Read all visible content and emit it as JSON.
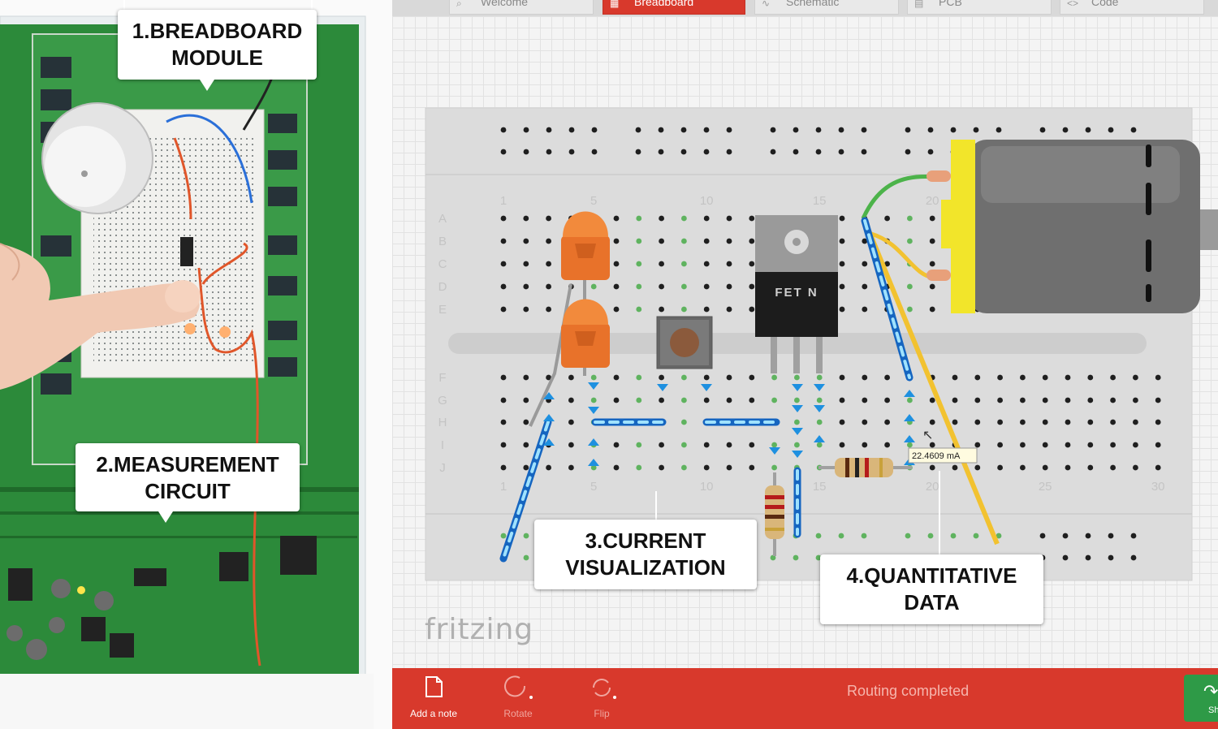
{
  "tabs": [
    {
      "label": "Welcome",
      "icon": "welcome-icon",
      "active": false
    },
    {
      "label": "Breadboard",
      "icon": "breadboard-icon",
      "active": true
    },
    {
      "label": "Schematic",
      "icon": "schematic-icon",
      "active": false
    },
    {
      "label": "PCB",
      "icon": "pcb-icon",
      "active": false
    },
    {
      "label": "Code",
      "icon": "code-icon",
      "active": false
    }
  ],
  "breadboard": {
    "column_numbers": [
      "1",
      "5",
      "10",
      "15",
      "20",
      "25",
      "30"
    ],
    "row_letters_top": [
      "A",
      "B",
      "C",
      "D",
      "E"
    ],
    "row_letters_bottom": [
      "F",
      "G",
      "H",
      "I",
      "J"
    ],
    "fet_label": "FET N",
    "current_reading": "22.4609 mA"
  },
  "logo_text": "fritzing",
  "toolbar": {
    "add_note": "Add a note",
    "rotate": "Rotate",
    "flip": "Flip",
    "status": "Routing completed",
    "share": "Sh"
  },
  "callouts": {
    "c1": [
      "1.BREADBOARD",
      "MODULE"
    ],
    "c2": [
      "2.MEASUREMENT",
      "CIRCUIT"
    ],
    "c3": [
      "3.CURRENT",
      "VISUALIZATION"
    ],
    "c4": [
      "4.QUANTITATIVE",
      "DATA"
    ]
  },
  "colors": {
    "accent_red": "#d8392c",
    "pcb_green": "#2c8a3a",
    "share_green": "#2e9a47",
    "led_orange": "#f07a2a",
    "current_blue": "#1e90e0"
  }
}
